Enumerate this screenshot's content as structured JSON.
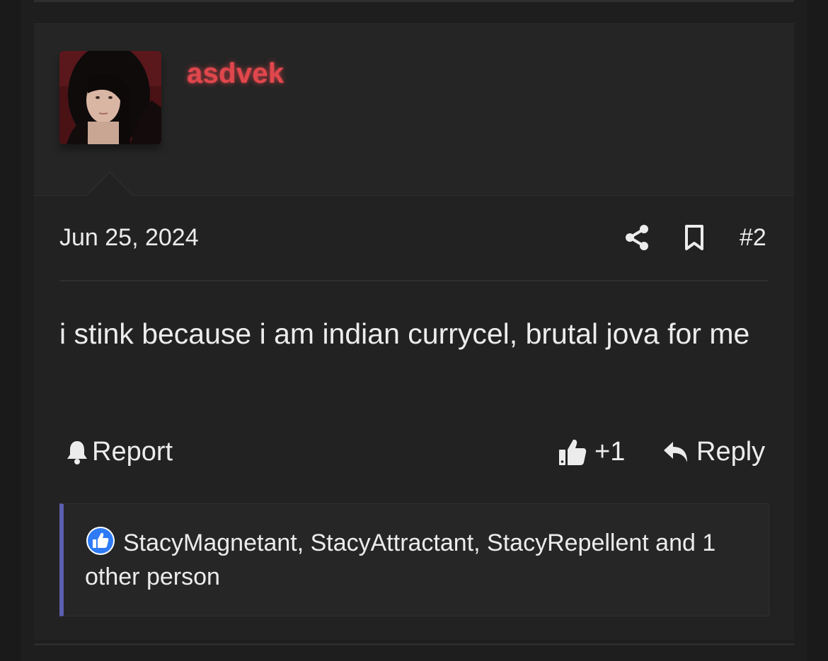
{
  "post": {
    "username": "asdvek",
    "date": "Jun 25, 2024",
    "post_number": "#2",
    "message": "i stink because i am indian currycel, brutal jova for me",
    "icons": [
      "share-icon",
      "bookmark-icon",
      "bell-icon",
      "thumbs-up-icon",
      "reply-icon",
      "like-reaction-icon"
    ]
  },
  "actions": {
    "report_label": "Report",
    "like_count": "+1",
    "reply_label": "Reply"
  },
  "reactions": {
    "text": "StacyMagnetant, StacyAttractant, StacyRepellent and 1 other person"
  },
  "colors": {
    "username": "#e0474c",
    "reaction_bar": "#5b5fb0",
    "like_badge": "#2f7bf6"
  }
}
